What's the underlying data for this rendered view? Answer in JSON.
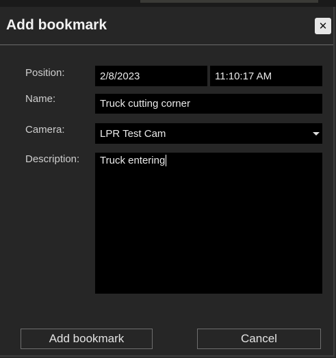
{
  "dialog": {
    "title": "Add bookmark",
    "close_glyph": "✕"
  },
  "form": {
    "position_label": "Position:",
    "date_value": "2/8/2023",
    "time_value": "11:10:17 AM",
    "name_label": "Name:",
    "name_value": "Truck cutting corner",
    "camera_label": "Camera:",
    "camera_value": "LPR Test Cam",
    "description_label": "Description:",
    "description_value": "Truck entering"
  },
  "buttons": {
    "add_label": "Add bookmark",
    "cancel_label": "Cancel"
  },
  "icons": {
    "close": "close-icon",
    "dropdown": "chevron-down-icon"
  }
}
